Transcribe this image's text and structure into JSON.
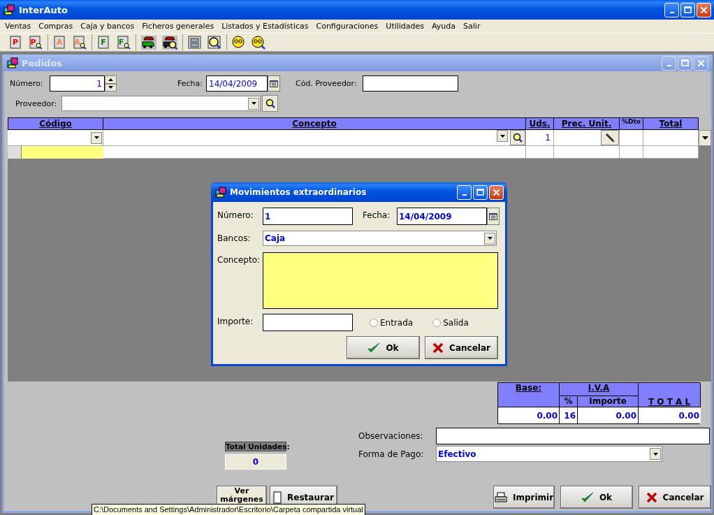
{
  "window": {
    "title": "InterAuto"
  },
  "menu": [
    "Ventas",
    "Compras",
    "Caja y bancos",
    "Ficheros generales",
    "Listados y Estadísticas",
    "Configuraciones",
    "Utilidades",
    "Ayuda",
    "Salir"
  ],
  "toolbar": [
    [
      {
        "kind": "letter-doc",
        "letter": "P",
        "color": "#ff0000"
      },
      {
        "kind": "letter-doc-search",
        "letter": "P",
        "color": "#ff0000"
      }
    ],
    [
      {
        "kind": "letter-doc",
        "letter": "A",
        "color": "#ff8040"
      },
      {
        "kind": "letter-doc-search",
        "letter": "A",
        "color": "#ff8040"
      }
    ],
    [
      {
        "kind": "letter-doc",
        "letter": "F",
        "color": "#008000"
      },
      {
        "kind": "letter-doc-search",
        "letter": "F",
        "color": "#008000"
      }
    ],
    [
      {
        "kind": "cars"
      },
      {
        "kind": "cars-search"
      }
    ],
    [
      {
        "kind": "panel"
      },
      {
        "kind": "panel-search"
      }
    ],
    [
      {
        "kind": "ball"
      },
      {
        "kind": "ball-search"
      }
    ]
  ],
  "pedidos": {
    "title": "Pedidos",
    "numero": {
      "label": "Número:",
      "value": "1"
    },
    "fecha": {
      "label": "Fecha:",
      "value": "14/04/2009"
    },
    "cod_proveedor": {
      "label": "Cód. Proveedor:"
    },
    "proveedor": {
      "label": "Proveedor:"
    },
    "grid": {
      "columns": [
        "Código",
        "Concepto",
        "Uds.",
        "Prec. Unit.",
        "%Dto",
        "Total"
      ],
      "uds": "1"
    },
    "totals": {
      "base_label": "Base:",
      "iva_label": "I.V.A",
      "pct_label": "%",
      "importe_label": "Importe",
      "total_label": "T O T A L",
      "base": "0.00",
      "pct": "16",
      "importe": "0.00",
      "total": "0.00"
    },
    "observaciones": {
      "label": "Observaciones:"
    },
    "forma_pago": {
      "label": "Forma de Pago:",
      "value": "Efectivo"
    },
    "total_unidades": {
      "label": "Total Unidades:",
      "value": "0"
    },
    "buttons": [
      {
        "kind": "plain",
        "label": "Ver márgenes"
      },
      {
        "kind": "restore",
        "label": "Restaurar"
      },
      {
        "kind": "print",
        "label": "Imprimir"
      },
      {
        "kind": "ok",
        "label": "Ok"
      },
      {
        "kind": "cancel",
        "label": "Cancelar"
      }
    ]
  },
  "dialog": {
    "title": "Movimientos extraordinarios",
    "numero": {
      "label": "Número:",
      "value": "1"
    },
    "fecha": {
      "label": "Fecha:",
      "value": "14/04/2009"
    },
    "bancos": {
      "label": "Bancos:",
      "value": "Caja"
    },
    "concepto": {
      "label": "Concepto:"
    },
    "importe": {
      "label": "Importe:"
    },
    "radios": [
      {
        "label": "Entrada",
        "selected": false
      },
      {
        "label": "Salida",
        "selected": false
      }
    ],
    "buttons": [
      {
        "kind": "ok",
        "label": "Ok"
      },
      {
        "kind": "cancel",
        "label": "Cancelar"
      }
    ]
  },
  "tooltip": "C:\\Documents and Settings\\Administrador\\Escritorio\\Carpeta compartida virtual"
}
